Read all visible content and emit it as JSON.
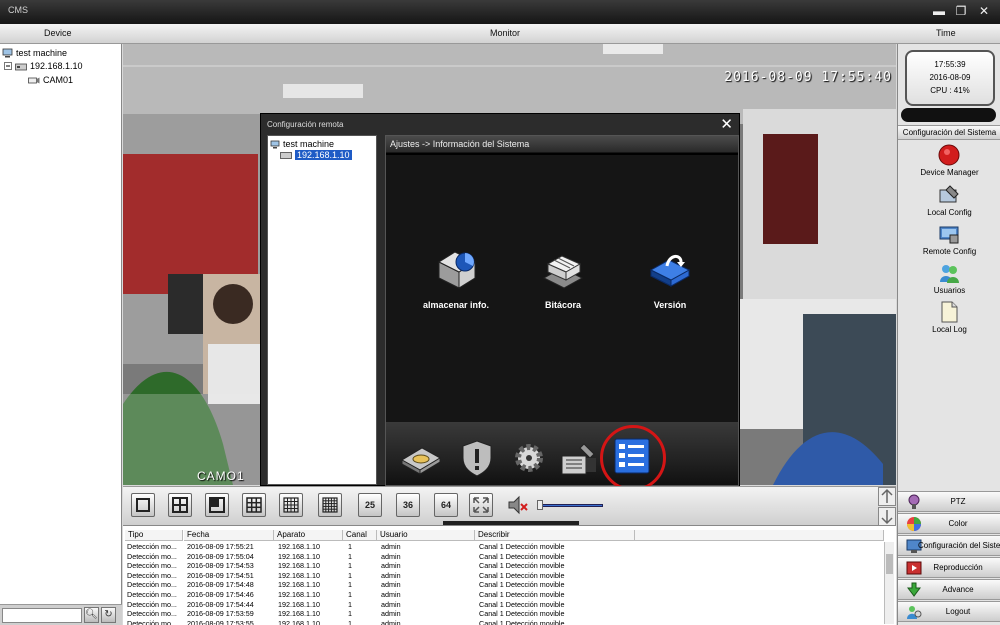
{
  "app": {
    "title": "CMS"
  },
  "header": {
    "device_label": "Device",
    "monitor_label": "Monitor",
    "time_label": "Time"
  },
  "device_tree": {
    "root": "test machine",
    "ip": "192.168.1.10",
    "camera": "CAM01"
  },
  "video": {
    "timestamp": "2016-08-09  17:55:40",
    "camera_name": "CAMO1"
  },
  "dialog": {
    "title": "Configuración remota",
    "tree_root": "test machine",
    "tree_ip": "192.168.1.10",
    "breadcrumb": "Ajustes -> Información del Sistema",
    "tools": [
      {
        "label": "almacenar info.",
        "icon": "hard-drive-icon"
      },
      {
        "label": "Bitácora",
        "icon": "log-icon"
      },
      {
        "label": "Versión",
        "icon": "version-icon"
      }
    ],
    "bottom_icons": [
      "disk-icon",
      "shield-icon",
      "gear-icon",
      "tools-icon",
      "info-icon"
    ]
  },
  "clock": {
    "time": "17:55:39",
    "date": "2016-08-09",
    "cpu": "CPU : 41%"
  },
  "system_config": {
    "header": "Configuración del Sistema",
    "items": [
      {
        "label": "Device Manager",
        "icon": "record-icon"
      },
      {
        "label": "Local Config",
        "icon": "local-config-icon"
      },
      {
        "label": "Remote Config",
        "icon": "remote-config-icon"
      },
      {
        "label": "Usuarios",
        "icon": "users-icon"
      },
      {
        "label": "Local Log",
        "icon": "document-icon"
      }
    ]
  },
  "bottom_menu": [
    {
      "label": "PTZ",
      "icon": "ptz-icon"
    },
    {
      "label": "Color",
      "icon": "color-icon"
    },
    {
      "label": "Configuración del Sistema",
      "icon": "config-icon"
    },
    {
      "label": "Reproducción",
      "icon": "playback-icon"
    },
    {
      "label": "Advance",
      "icon": "advance-icon"
    },
    {
      "label": "Logout",
      "icon": "logout-icon"
    }
  ],
  "toolbar": {
    "layout_buttons": [
      "",
      "",
      "",
      "",
      "",
      "",
      "25",
      "36",
      "64"
    ],
    "icons": [
      "single-view-icon",
      "quad-view-icon",
      "six-view-icon",
      "nine-view-icon",
      "sixteen-view-icon",
      "sixteen-grid-icon",
      "view-25-icon",
      "view-36-icon",
      "view-64-icon"
    ],
    "volume_level": 0.1
  },
  "log": {
    "columns": [
      "Tipo",
      "Fecha",
      "Aparato",
      "Canal",
      "Usuario",
      "Describir"
    ],
    "rows": [
      [
        "Detección mo...",
        "2016-08-09 17:55:21",
        "192.168.1.10",
        "1",
        "admin",
        "Canal 1 Detección movible"
      ],
      [
        "Detección mo...",
        "2016-08-09 17:55:04",
        "192.168.1.10",
        "1",
        "admin",
        "Canal 1 Detección movible"
      ],
      [
        "Detección mo...",
        "2016-08-09 17:54:53",
        "192.168.1.10",
        "1",
        "admin",
        "Canal 1 Detección movible"
      ],
      [
        "Detección mo...",
        "2016-08-09 17:54:51",
        "192.168.1.10",
        "1",
        "admin",
        "Canal 1 Detección movible"
      ],
      [
        "Detección mo...",
        "2016-08-09 17:54:48",
        "192.168.1.10",
        "1",
        "admin",
        "Canal 1 Detección movible"
      ],
      [
        "Detección mo...",
        "2016-08-09 17:54:46",
        "192.168.1.10",
        "1",
        "admin",
        "Canal 1 Detección movible"
      ],
      [
        "Detección mo...",
        "2016-08-09 17:54:44",
        "192.168.1.10",
        "1",
        "admin",
        "Canal 1 Detección movible"
      ],
      [
        "Detección mo...",
        "2016-08-09 17:53:59",
        "192.168.1.10",
        "1",
        "admin",
        "Canal 1 Detección movible"
      ],
      [
        "Detección mo...",
        "2016-08-09 17:53:55",
        "192.168.1.10",
        "1",
        "admin",
        "Canal 1 Detección movible"
      ]
    ]
  }
}
